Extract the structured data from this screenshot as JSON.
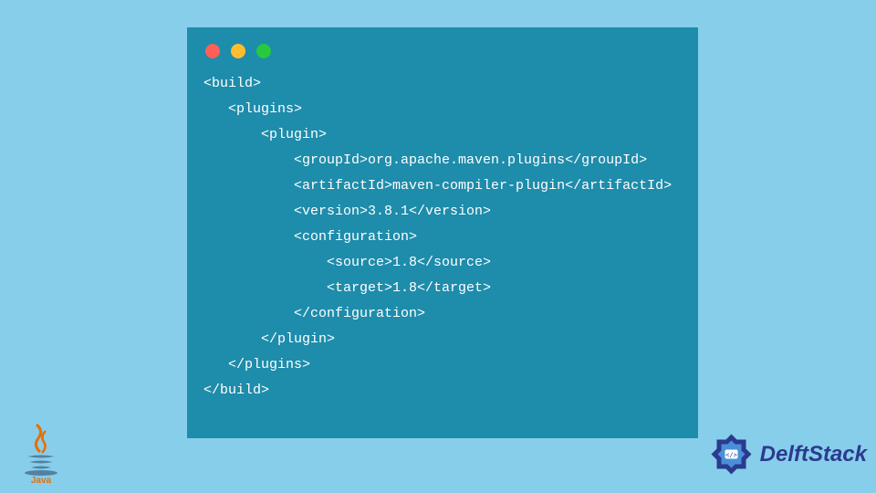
{
  "code": {
    "lines": [
      "<build>",
      "   <plugins>",
      "       <plugin>",
      "           <groupId>org.apache.maven.plugins</groupId>",
      "           <artifactId>maven-compiler-plugin</artifactId>",
      "           <version>3.8.1</version>",
      "           <configuration>",
      "               <source>1.8</source>",
      "               <target>1.8</target>",
      "           </configuration>",
      "       </plugin>",
      "   </plugins>",
      "</build>"
    ]
  },
  "logos": {
    "java_label": "Java",
    "delft_label": "DelftStack"
  }
}
